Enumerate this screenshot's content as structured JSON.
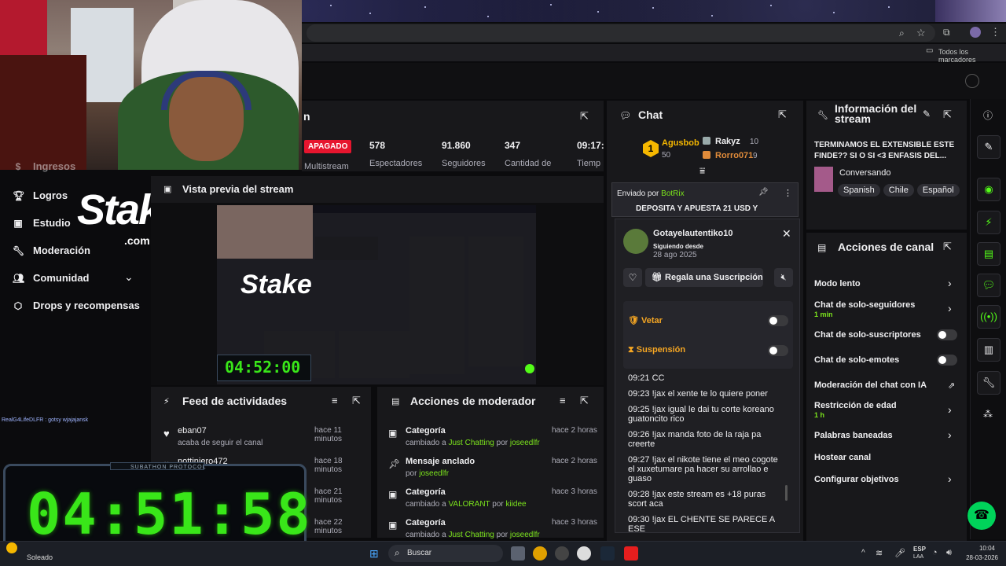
{
  "browser": {
    "bookmarks_label": "Todos los marcadores"
  },
  "nav": {
    "items": [
      {
        "label": "Logros",
        "icon": "trophy-icon"
      },
      {
        "label": "Estudio",
        "icon": "video-icon"
      },
      {
        "label": "Moderación",
        "icon": "wrench-icon"
      },
      {
        "label": "Comunidad",
        "icon": "people-icon"
      },
      {
        "label": "Drops y recompensas",
        "icon": "drop-icon"
      }
    ],
    "partial_label": "Ingresos"
  },
  "sponsor": {
    "word": "Stake",
    "suffix": ".com"
  },
  "stats": {
    "status_badge": "APAGADO",
    "platform": "Multistream",
    "items": [
      {
        "value": "578",
        "label": "Espectadores"
      },
      {
        "value": "91.860",
        "label": "Seguidores"
      },
      {
        "value": "347",
        "label": "Cantidad de"
      },
      {
        "value": "09:17:",
        "label": "Tiemp"
      }
    ]
  },
  "preview": {
    "title": "Vista previa del stream",
    "timer": "04:52:00"
  },
  "feed": {
    "title": "Feed de actividades",
    "items": [
      {
        "user": "eban07",
        "action": "acaba de seguir el canal",
        "time": "hace 11 minutos"
      },
      {
        "user": "nottiniero472",
        "action": "",
        "time": "hace 18 minutos"
      },
      {
        "user": "",
        "action": "",
        "time": "hace 21 minutos"
      },
      {
        "user": "",
        "action": "",
        "time": "hace 22 minutos"
      }
    ]
  },
  "modactions": {
    "title": "Acciones de moderador",
    "items": [
      {
        "title": "Categoría",
        "detail_pre": "cambiado a ",
        "detail_hl": "Just Chatting",
        "detail_mid": " por ",
        "detail_user": "joseedlfr",
        "time": "hace 2 horas"
      },
      {
        "title": "Mensaje anclado",
        "detail_pre": "por ",
        "detail_hl": "",
        "detail_mid": "",
        "detail_user": "joseedlfr",
        "time": "hace 2 horas"
      },
      {
        "title": "Categoría",
        "detail_pre": "cambiado a ",
        "detail_hl": "VALORANT",
        "detail_mid": " por ",
        "detail_user": "kiidee",
        "time": "hace 3 horas"
      },
      {
        "title": "Categoría",
        "detail_pre": "cambiado a ",
        "detail_hl": "Just Chatting",
        "detail_mid": " por ",
        "detail_user": "joseedlfr",
        "time": "hace 3 horas"
      }
    ]
  },
  "chat": {
    "title": "Chat",
    "leaders": [
      {
        "rank": "1",
        "name": "Agusbob",
        "points": "50"
      },
      {
        "rank": "",
        "name": "Rakyz",
        "points": "10"
      },
      {
        "rank": "",
        "name": "Rorro071",
        "points": "9"
      }
    ],
    "pinned_by": "Enviado por",
    "pinned_user": "BotRix",
    "pinned_text": "DEPOSITA Y APUESTA 21 USD Y",
    "popup": {
      "username": "Gotayelautentiko10",
      "following_label": "Siguiendo desde",
      "following_date": "28 ago 2025",
      "gift_label": "Regala una Suscripción",
      "veto_label": "Vetar",
      "suspend_label": "Suspensión",
      "messages": [
        "09:21 CC",
        "09:23 !jax el xente te lo quiere poner",
        "09:25 !jax igual le dai tu corte koreano guatoncito rico",
        "09:26 !jax manda foto de la raja pa creerte",
        "09:27 !jax el nikote tiene el meo cogote el xuxetumare pa hacer su arrollao e guaso",
        "09:28 !jax este stream es +18 puras scort aca",
        "09:30 !jax EL CHENTE SE PARECE A ESE"
      ]
    }
  },
  "info": {
    "title": "Información del stream",
    "stream_title": "TERMINAMOS EL EXTENSIBLE ESTE FINDE?? SI O SI <3 ENFASIS DEL...",
    "category": "Conversando",
    "tags": [
      "Spanish",
      "Chile",
      "Español"
    ]
  },
  "channel_actions": {
    "title": "Acciones de canal",
    "items": [
      {
        "label": "Modo lento",
        "sub": "",
        "control": "chevron"
      },
      {
        "label": "Chat de solo-seguidores",
        "sub": "1 min",
        "control": "chevron"
      },
      {
        "label": "Chat de solo-suscriptores",
        "sub": "",
        "control": "toggle"
      },
      {
        "label": "Chat de solo-emotes",
        "sub": "",
        "control": "toggle"
      },
      {
        "label": "Moderación del chat con IA",
        "sub": "",
        "control": "external"
      },
      {
        "label": "Restricción de edad",
        "sub": "1 h",
        "control": "chevron"
      },
      {
        "label": "Palabras baneadas",
        "sub": "",
        "control": "chevron"
      },
      {
        "label": "Hostear canal",
        "sub": "",
        "control": "none"
      },
      {
        "label": "Configurar objetivos",
        "sub": "",
        "control": "chevron"
      }
    ]
  },
  "overlay": {
    "chat_line": "RealG4LifeDLFR : gotsy wjajajansk",
    "timer_title": "SUBATHON PROTOCOL",
    "timer": "04:51:58",
    "weather": "Soleado"
  },
  "taskbar": {
    "search": "Buscar",
    "lang": "ESP",
    "lang_sub": "LAA",
    "time": "10:04",
    "date": "28-03-2026"
  },
  "colors": {
    "accent": "#53fc18",
    "panel": "#18181b",
    "timer_green": "#39e619",
    "badge_red": "#e6152e"
  }
}
